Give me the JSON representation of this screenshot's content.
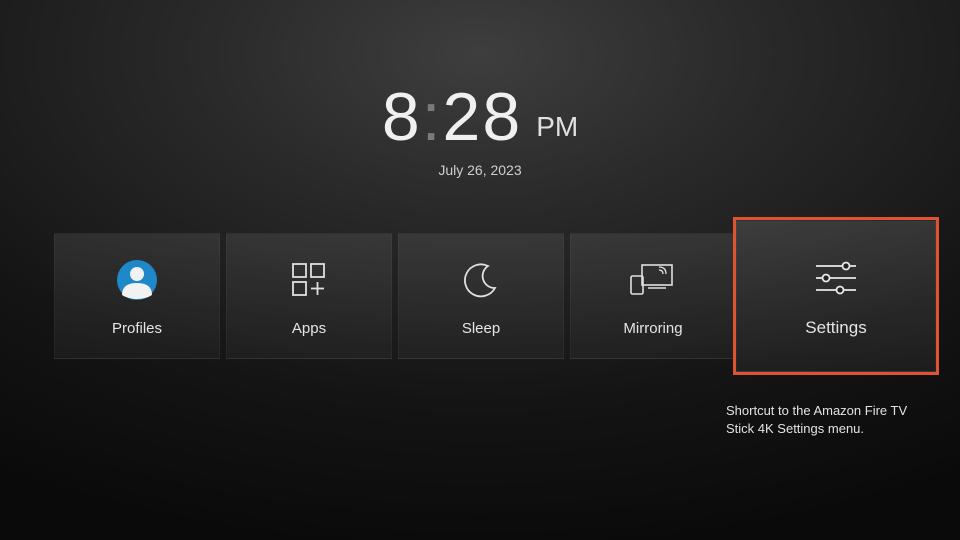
{
  "clock": {
    "hour": "8",
    "minute": "28",
    "suffix": "PM",
    "date": "July 26, 2023"
  },
  "tiles": {
    "profiles": {
      "label": "Profiles"
    },
    "apps": {
      "label": "Apps"
    },
    "sleep": {
      "label": "Sleep"
    },
    "mirroring": {
      "label": "Mirroring"
    },
    "settings": {
      "label": "Settings"
    }
  },
  "selected": "settings",
  "caption": "Shortcut to the Amazon Fire TV Stick 4K Settings menu.",
  "colors": {
    "highlight": "#e0532f",
    "profile_accent": "#1e88c8"
  }
}
